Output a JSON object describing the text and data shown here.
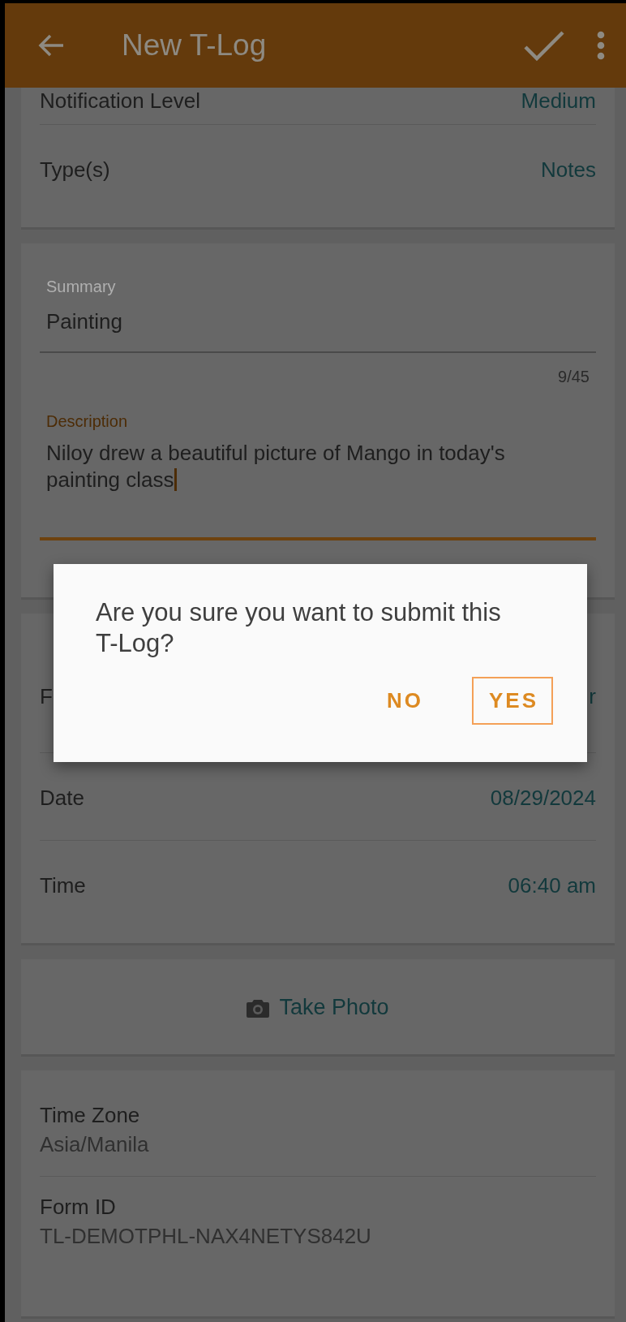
{
  "app_bar": {
    "title": "New T-Log"
  },
  "sections": [
    {
      "kind": "rows",
      "rows": [
        {
          "label": "Notification Level",
          "value": "Medium"
        },
        {
          "label": "Type(s)",
          "value": "Notes"
        }
      ]
    },
    {
      "kind": "fields",
      "fields": [
        {
          "label": "Summary",
          "value": "Painting",
          "counter": "9/45",
          "focused": false
        },
        {
          "label": "Description",
          "value": "Niloy drew a beautiful picture of Mango in today's painting class",
          "focused": true
        }
      ]
    },
    {
      "kind": "rows",
      "rows": [
        {
          "label": "F",
          "value": "r"
        },
        {
          "label": "Date",
          "value": "08/29/2024"
        },
        {
          "label": "Time",
          "value": "06:40 am"
        }
      ]
    },
    {
      "kind": "action",
      "label": "Take Photo"
    },
    {
      "kind": "info",
      "items": [
        {
          "label": "Time Zone",
          "value": "Asia/Manila"
        },
        {
          "label": "Form ID",
          "value": "TL-DEMOTPHL-NAX4NETYS842U"
        }
      ]
    }
  ],
  "dialog": {
    "message": "Are you sure you want to submit this T-Log?",
    "buttons": [
      {
        "label": "NO",
        "focused": false
      },
      {
        "label": "YES",
        "focused": true
      }
    ]
  }
}
